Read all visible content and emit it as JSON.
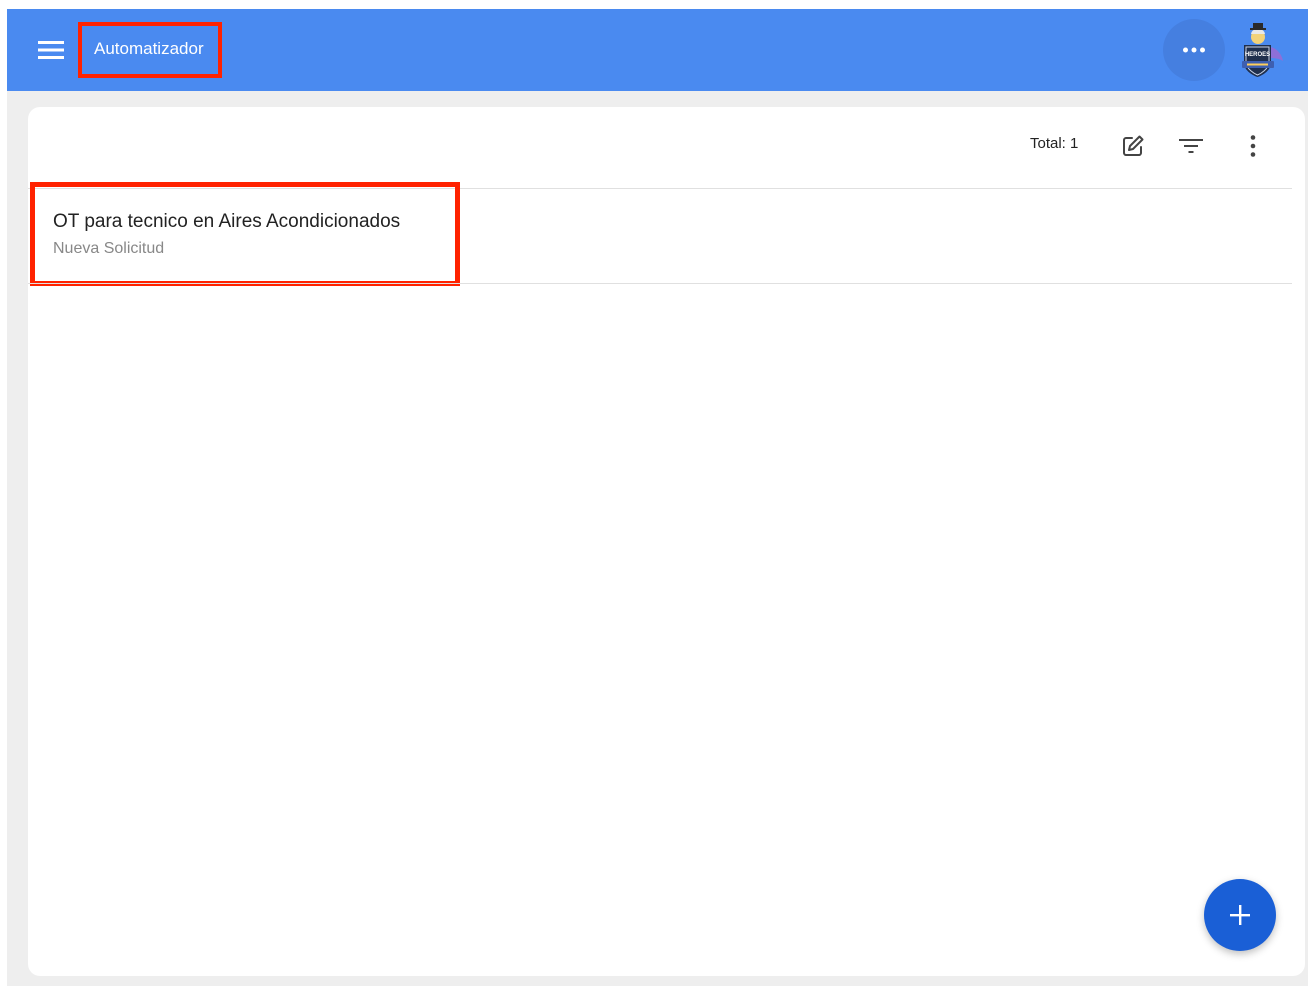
{
  "appbar": {
    "title": "Automatizador",
    "menu_icon": "hamburger-menu-icon",
    "more_icon": "more-horizontal-icon",
    "avatar_badge": "HEROES",
    "color": "#4a8af0"
  },
  "toolbar": {
    "total_label": "Total: 1",
    "edit_icon": "edit-icon",
    "filter_icon": "filter-icon",
    "more_icon": "more-vertical-icon"
  },
  "list": {
    "items": [
      {
        "title": "OT para tecnico en Aires Acondicionados",
        "subtitle": "Nueva Solicitud"
      }
    ]
  },
  "fab": {
    "icon": "plus-icon",
    "color": "#1a5fd6"
  },
  "highlight_color": "#ff2200"
}
